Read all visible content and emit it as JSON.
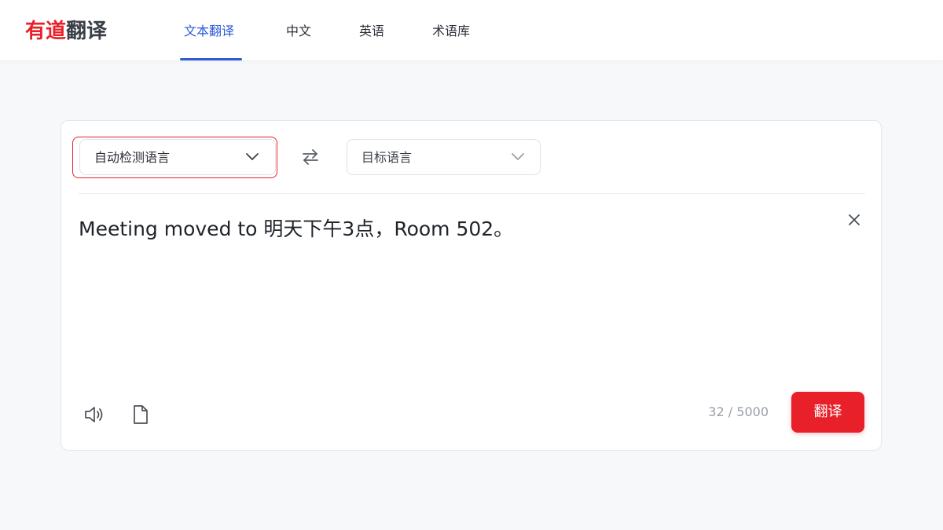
{
  "brand": {
    "logo_part1": "有道",
    "logo_part2": "翻译",
    "primary_color": "#e8202a",
    "accent_color": "#2f5bd8"
  },
  "nav": {
    "items": [
      {
        "label": "文本翻译",
        "active": true
      },
      {
        "label": "中文",
        "active": false
      },
      {
        "label": "英语",
        "active": false
      },
      {
        "label": "术语库",
        "active": false
      }
    ]
  },
  "translator": {
    "source_language": "自动检测语言",
    "target_language": "目标语言",
    "swap_icon": "swap-arrows-icon",
    "source_text": "Meeting moved to 明天下午3点，Room 502。",
    "clear_icon": "close-icon",
    "speaker_icon": "speaker-icon",
    "document_icon": "document-icon",
    "char_count": "32 / 5000",
    "translate_label": "翻译"
  }
}
